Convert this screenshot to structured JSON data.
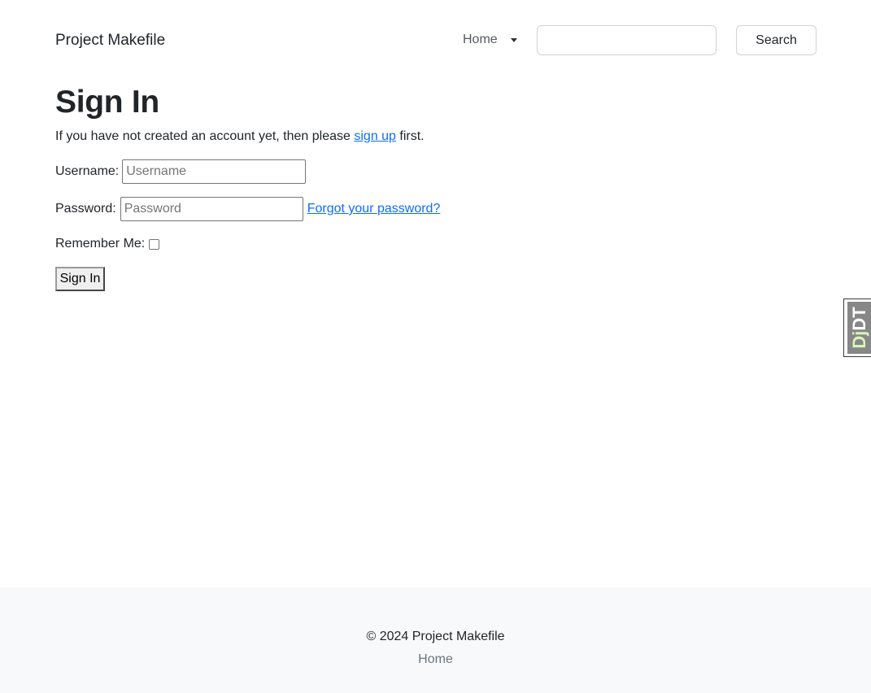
{
  "navbar": {
    "brand": "Project Makefile",
    "dropdown_label": "Home",
    "search": {
      "value": "",
      "placeholder": ""
    },
    "search_button": "Search"
  },
  "main": {
    "title": "Sign In",
    "intro_before": "If you have not created an account yet, then please ",
    "intro_link": "sign up",
    "intro_after": " first.",
    "username": {
      "label": "Username:",
      "placeholder": "Username",
      "value": ""
    },
    "password": {
      "label": "Password:",
      "placeholder": "Password",
      "value": ""
    },
    "forgot_link": "Forgot your password?",
    "remember": {
      "label": "Remember Me:",
      "checked": false
    },
    "submit": "Sign In"
  },
  "debug_toolbar": {
    "label_dj": "Dj",
    "label_dt": "DT"
  },
  "footer": {
    "copyright": "© 2024 Project Makefile",
    "link": "Home"
  },
  "colors": {
    "link": "#0d6efd",
    "footer_bg": "#f8f9fa",
    "muted": "#6c757d"
  }
}
